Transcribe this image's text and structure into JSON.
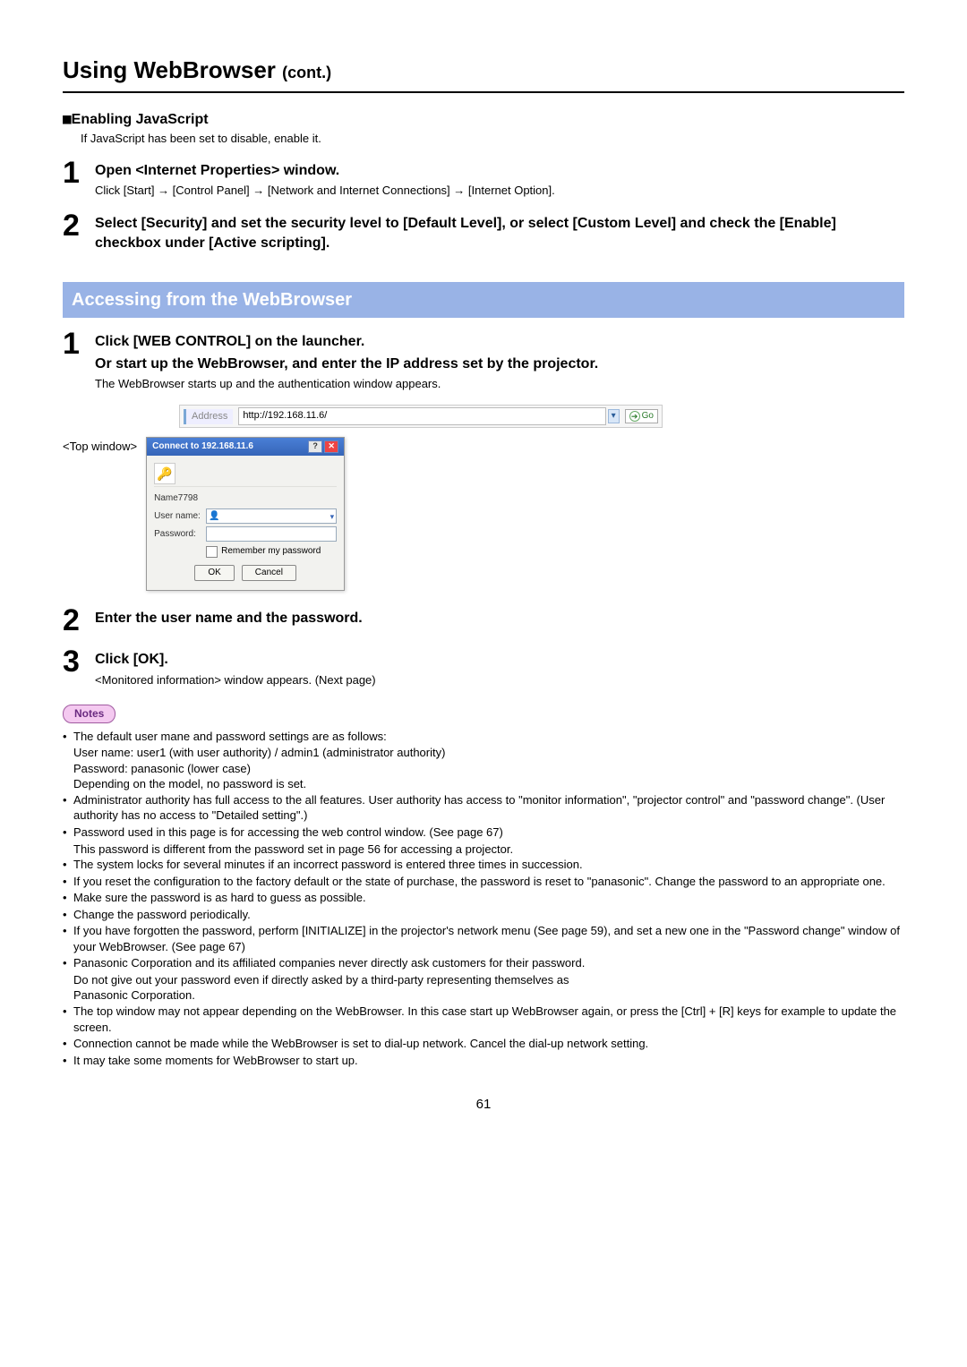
{
  "title_main": "Using WebBrowser ",
  "title_cont": "(cont.)",
  "sub_enable_js": "Enabling JavaScript",
  "enable_js_desc": "If JavaScript has been set to disable, enable it.",
  "steps_a": {
    "1": {
      "num": "1",
      "heading": "Open <Internet Properties> window.",
      "desc": "Click [Start] → [Control Panel] → [Network and Internet Connections] → [Internet Option]."
    },
    "2": {
      "num": "2",
      "heading": "Select [Security] and set the security level to [Default Level], or select [Custom Level] and check the [Enable] checkbox under [Active scripting]."
    }
  },
  "section_banner": "Accessing from the WebBrowser",
  "steps_b": {
    "1": {
      "num": "1",
      "heading1": "Click [WEB CONTROL] on the launcher.",
      "heading2": "Or start up the WebBrowser, and enter the IP address set by the projector.",
      "desc": "The WebBrowser starts up and the authentication window appears."
    },
    "2": {
      "num": "2",
      "heading": "Enter the user name and the password."
    },
    "3": {
      "num": "3",
      "heading": "Click [OK].",
      "desc": "<Monitored information> window appears. (Next page)"
    }
  },
  "address_bar": {
    "label": "Address",
    "url": "http://192.168.11.6/",
    "go": "Go"
  },
  "top_window_label": "<Top window>",
  "dialog": {
    "title": "Connect to 192.168.11.6",
    "site": "Name7798",
    "user_label": "User name:",
    "pass_label": "Password:",
    "remember": "Remember my password",
    "ok": "OK",
    "cancel": "Cancel"
  },
  "notes_label": "Notes",
  "notes": {
    "n1": "The default user mane and password settings are as follows:",
    "n1a": "User name: user1 (with user authority) / admin1 (administrator authority)",
    "n1b": "Password: panasonic (lower case)",
    "n1c": "Depending on the model, no password is set.",
    "n2": "Administrator authority has full access to the all features. User authority has access to \"monitor information\", \"projector control\" and \"password change\". (User authority has no access to \"Detailed setting\".)",
    "n3": "Password used in this page is for accessing the web control window. (See page 67)",
    "n3a": "This password is different from the password set in page 56 for accessing a projector.",
    "n4": "The system locks for several minutes if an incorrect password is entered three times in succession.",
    "n5": "If you reset the configuration to the factory default or the state of purchase, the password is reset to \"panasonic\". Change the password to an appropriate one.",
    "n6": "Make sure the password is as hard to guess as possible.",
    "n7": "Change the password periodically.",
    "n8": "If you have forgotten the password, perform [INITIALIZE] in the projector's network menu (See page 59), and set a new one in the \"Password change\" window of your WebBrowser. (See page 67)",
    "n9": "Panasonic Corporation and its affiliated companies never directly ask customers for their password.",
    "n9a": "Do not give out your password even if directly asked by a third-party representing themselves as",
    "n9b": "Panasonic Corporation.",
    "n10": "The top window may not appear depending on the WebBrowser. In this case start up WebBrowser again, or press the [Ctrl] + [R] keys for example to update the screen.",
    "n11": "Connection cannot be made while the WebBrowser is set to dial-up network. Cancel the dial-up network setting.",
    "n12": "It may take some moments for WebBrowser to start up."
  },
  "page_number": "61"
}
